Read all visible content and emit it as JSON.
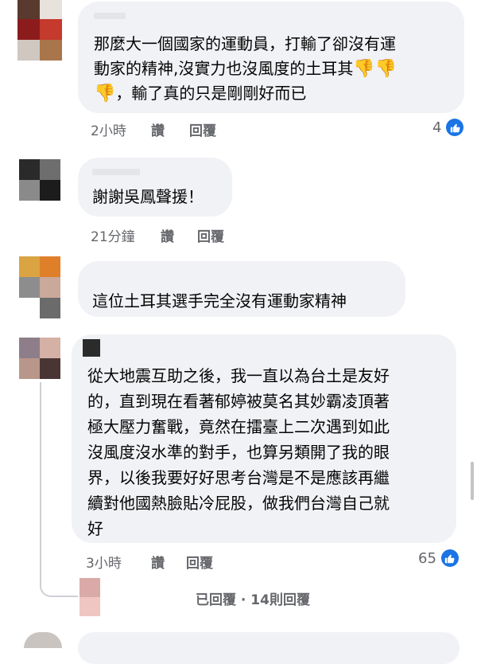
{
  "comments": [
    {
      "text": "那麼大一個國家的運動員，打輸了卻沒有運動家的精神,沒實力也沒風度的土耳其👎👎👎，輸了真的只是剛剛好而已",
      "line1": "那麼大一個國家的運動員，打輸了卻沒有運",
      "line2": "動家的精神,沒實力也沒風度的土耳其",
      "line3": "，輸了真的只是剛剛好而已",
      "time": "2小時",
      "read": "讚",
      "reply": "回覆",
      "likes": "4",
      "avatar_colors": [
        "#5a3a2e",
        "#e8e2dd",
        "#8c1c1c",
        "#c43a2c",
        "#cfc7c0",
        "#a8764a"
      ]
    },
    {
      "text": "謝謝吳鳳聲援！",
      "time": "21分鐘",
      "read": "讚",
      "reply": "回覆",
      "avatar_colors": [
        "#2a2a2a",
        "#6e6e6e",
        "#8a8a8a",
        "#1c1c1c"
      ]
    },
    {
      "text": "這位土耳其選手完全沒有運動家精神",
      "time": "",
      "read": "",
      "reply": "",
      "avatar_colors": [
        "#d9a441",
        "#e07f2a",
        "#8d8d8d",
        "#caa89a",
        "#e8e4e0",
        "#b89084",
        "#ffffff",
        "#6b6b6b"
      ]
    },
    {
      "lines": [
        "從大地震互助之後，我一直以為台土是友好",
        "的，直到現在看著郁婷被莫名其妙霸凌頂著",
        "極大壓力奮戰，竟然在擂臺上二次遇到如此",
        "沒風度沒水準的對手，也算另類開了我的眼",
        "界，以後我要好好思考台灣是不是應該再繼",
        "續對他國熱臉貼冷屁股，做我們台灣自己就",
        "好"
      ],
      "time": "3小時",
      "read": "讚",
      "reply": "回覆",
      "likes": "65",
      "avatar_colors": [
        "#8d7e8a",
        "#d4b0a5",
        "#b8968a",
        "#4a3535"
      ]
    }
  ],
  "replies_summary": {
    "text": "已回覆 · 14則回覆"
  },
  "colors": {
    "bubble": "#f0f2f5",
    "meta": "#65676b",
    "like_blue": "#1b74e4",
    "emoji": "#f4b400"
  }
}
